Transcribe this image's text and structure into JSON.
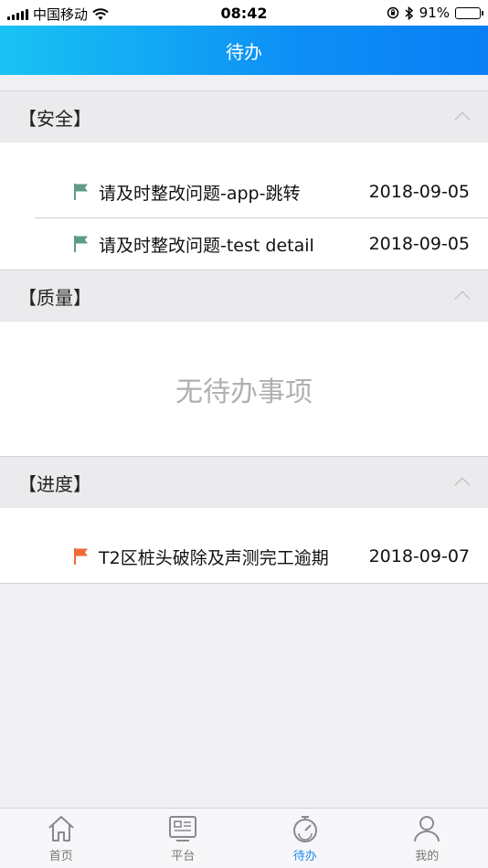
{
  "status_bar": {
    "carrier": "中国移动",
    "time": "08:42",
    "battery": "91%",
    "battery_level": 0.91
  },
  "nav": {
    "title": "待办"
  },
  "sections": [
    {
      "title": "【安全】",
      "items": [
        {
          "title": "请及时整改问题-app-跳转",
          "date": "2018-09-05",
          "flag_color": "#5e9b8a"
        },
        {
          "title": "请及时整改问题-test detail",
          "date": "2018-09-05",
          "flag_color": "#5e9b8a"
        }
      ]
    },
    {
      "title": "【质量】",
      "empty_text": "无待办事项"
    },
    {
      "title": "【进度】",
      "items": [
        {
          "title": "T2区桩头破除及声测完工逾期",
          "date": "2018-09-07",
          "flag_color": "#f06a3a"
        }
      ]
    }
  ],
  "tabbar": {
    "tabs": [
      {
        "label": "首页",
        "icon": "home-icon"
      },
      {
        "label": "平台",
        "icon": "platform-icon"
      },
      {
        "label": "待办",
        "icon": "todo-icon",
        "active": true
      },
      {
        "label": "我的",
        "icon": "user-icon"
      }
    ]
  },
  "colors": {
    "accent": "#1a8cf0",
    "nav_gradient_start": "#19c3f3",
    "nav_gradient_end": "#0a7ff5"
  }
}
